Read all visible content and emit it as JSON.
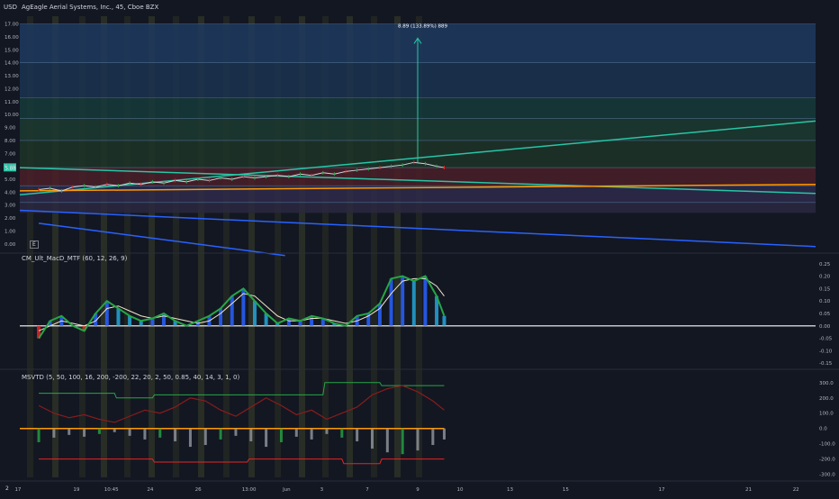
{
  "header": {
    "title": "AgEagle Aerial Systems, Inc., 45, Cboe BZX",
    "currency": "USD",
    "price_tag": "5.88",
    "measure_label": "8.89 (133.89%) 889",
    "settings_label": "E",
    "corner_label": "2"
  },
  "panes": {
    "macd_title": "CM_Ult_MacD_MTF (60, 12, 26, 9)",
    "msvtd_title": "MSVTD (5, 50, 100, 16, 200, -200, 22, 20, 2, 50, 0.85, 40, 14, 3, 1, 0)"
  },
  "colors": {
    "background": "#131722",
    "teal": "#26c6a6",
    "blue": "#2962ff",
    "green": "#26a645",
    "red": "#e52525",
    "orange": "#ff9800",
    "zone_blue": "#1f3a5f",
    "zone_green": "#1c3a30",
    "zone_red": "#4a1f28",
    "zone_purple": "#2e2a4a"
  },
  "chart_data": [
    {
      "type": "line",
      "pane": "price",
      "ylim": [
        -0.5,
        17.6
      ],
      "yticks": [
        "17.00",
        "16.00",
        "15.00",
        "14.00",
        "13.00",
        "12.00",
        "11.00",
        "10.00",
        "9.00",
        "8.00",
        "7.00",
        "6.00",
        "5.00",
        "4.00",
        "3.00",
        "2.00",
        "1.00",
        "0.00"
      ],
      "ytick_values": [
        17,
        16,
        15,
        14,
        13,
        12,
        11,
        10,
        9,
        8,
        7,
        6,
        5,
        4,
        3,
        2,
        1,
        0
      ],
      "zones": [
        {
          "from": 14.0,
          "to": 17.0,
          "color": "#1f3a5f"
        },
        {
          "from": 11.3,
          "to": 14.0,
          "color": "#1b3350"
        },
        {
          "from": 9.7,
          "to": 11.3,
          "color": "#163a3a"
        },
        {
          "from": 8.0,
          "to": 9.7,
          "color": "#1c3a30"
        },
        {
          "from": 5.9,
          "to": 8.0,
          "color": "#1d3428"
        },
        {
          "from": 4.5,
          "to": 5.9,
          "color": "#4a1f28"
        },
        {
          "from": 3.2,
          "to": 4.5,
          "color": "#2e2a4a"
        },
        {
          "from": 2.4,
          "to": 3.2,
          "color": "#2a2840"
        }
      ],
      "price": [
        [
          0,
          4.2
        ],
        [
          6,
          4.3
        ],
        [
          12,
          4.1
        ],
        [
          18,
          4.4
        ],
        [
          24,
          4.5
        ],
        [
          30,
          4.4
        ],
        [
          36,
          4.6
        ],
        [
          42,
          4.5
        ],
        [
          48,
          4.7
        ],
        [
          54,
          4.6
        ],
        [
          60,
          4.8
        ],
        [
          66,
          4.7
        ],
        [
          72,
          4.9
        ],
        [
          78,
          4.8
        ],
        [
          84,
          5.0
        ],
        [
          90,
          4.9
        ],
        [
          96,
          5.1
        ],
        [
          102,
          5.0
        ],
        [
          108,
          5.2
        ],
        [
          114,
          5.1
        ],
        [
          120,
          5.2
        ],
        [
          126,
          5.3
        ],
        [
          132,
          5.2
        ],
        [
          138,
          5.4
        ],
        [
          144,
          5.3
        ],
        [
          150,
          5.5
        ],
        [
          156,
          5.4
        ],
        [
          162,
          5.6
        ],
        [
          168,
          5.7
        ],
        [
          174,
          5.8
        ],
        [
          180,
          5.9
        ],
        [
          186,
          6.0
        ],
        [
          192,
          6.1
        ],
        [
          198,
          6.3
        ],
        [
          204,
          6.2
        ],
        [
          210,
          6.0
        ],
        [
          214,
          5.9
        ]
      ],
      "trendlines": [
        {
          "color": "#26c6a6",
          "from": [
            -10,
            3.8
          ],
          "to": [
            410,
            9.5
          ]
        },
        {
          "color": "#26c6a6",
          "from": [
            -10,
            5.9
          ],
          "to": [
            410,
            3.9
          ]
        },
        {
          "color": "#2962ff",
          "from": [
            -10,
            2.6
          ],
          "to": [
            410,
            -0.2
          ]
        },
        {
          "color": "#2962ff",
          "from": [
            0,
            1.6
          ],
          "to": [
            130,
            -0.9
          ]
        },
        {
          "color": "#ff9800",
          "from": [
            -10,
            4.1
          ],
          "to": [
            410,
            4.6
          ]
        }
      ],
      "measure": {
        "x": 200,
        "from": 6.3,
        "to": 15.9
      },
      "price_level": 5.88
    },
    {
      "type": "line",
      "pane": "macd",
      "ylim": [
        -0.16,
        0.26
      ],
      "yticks": [
        "0.25",
        "0.20",
        "0.15",
        "0.10",
        "0.05",
        "0.00",
        "-0.05",
        "-0.10",
        "-0.15"
      ],
      "ytick_values": [
        0.25,
        0.2,
        0.15,
        0.1,
        0.05,
        0,
        -0.05,
        -0.1,
        -0.15
      ],
      "macd": [
        [
          0,
          -0.05
        ],
        [
          6,
          0.02
        ],
        [
          12,
          0.04
        ],
        [
          18,
          0.0
        ],
        [
          24,
          -0.02
        ],
        [
          30,
          0.05
        ],
        [
          36,
          0.1
        ],
        [
          42,
          0.07
        ],
        [
          48,
          0.04
        ],
        [
          54,
          0.02
        ],
        [
          60,
          0.03
        ],
        [
          66,
          0.05
        ],
        [
          72,
          0.02
        ],
        [
          78,
          0.0
        ],
        [
          84,
          0.02
        ],
        [
          90,
          0.04
        ],
        [
          96,
          0.07
        ],
        [
          102,
          0.12
        ],
        [
          108,
          0.15
        ],
        [
          114,
          0.1
        ],
        [
          120,
          0.05
        ],
        [
          126,
          0.01
        ],
        [
          132,
          0.03
        ],
        [
          138,
          0.02
        ],
        [
          144,
          0.04
        ],
        [
          150,
          0.03
        ],
        [
          156,
          0.01
        ],
        [
          162,
          0.0
        ],
        [
          168,
          0.04
        ],
        [
          174,
          0.05
        ],
        [
          180,
          0.09
        ],
        [
          186,
          0.19
        ],
        [
          192,
          0.2
        ],
        [
          198,
          0.18
        ],
        [
          204,
          0.2
        ],
        [
          210,
          0.12
        ],
        [
          214,
          0.04
        ]
      ],
      "signal": [
        [
          0,
          -0.02
        ],
        [
          6,
          0.0
        ],
        [
          12,
          0.02
        ],
        [
          18,
          0.01
        ],
        [
          24,
          0.0
        ],
        [
          30,
          0.02
        ],
        [
          36,
          0.07
        ],
        [
          42,
          0.08
        ],
        [
          48,
          0.06
        ],
        [
          54,
          0.04
        ],
        [
          60,
          0.03
        ],
        [
          66,
          0.04
        ],
        [
          72,
          0.03
        ],
        [
          78,
          0.02
        ],
        [
          84,
          0.01
        ],
        [
          90,
          0.02
        ],
        [
          96,
          0.05
        ],
        [
          102,
          0.09
        ],
        [
          108,
          0.13
        ],
        [
          114,
          0.12
        ],
        [
          120,
          0.08
        ],
        [
          126,
          0.04
        ],
        [
          132,
          0.02
        ],
        [
          138,
          0.02
        ],
        [
          144,
          0.03
        ],
        [
          150,
          0.03
        ],
        [
          156,
          0.02
        ],
        [
          162,
          0.01
        ],
        [
          168,
          0.02
        ],
        [
          174,
          0.04
        ],
        [
          180,
          0.07
        ],
        [
          186,
          0.13
        ],
        [
          192,
          0.18
        ],
        [
          198,
          0.19
        ],
        [
          204,
          0.19
        ],
        [
          210,
          0.16
        ],
        [
          214,
          0.12
        ]
      ]
    },
    {
      "type": "line",
      "pane": "msvtd",
      "ylim": [
        -320,
        340
      ],
      "yticks": [
        "300.0",
        "200.0",
        "100.0",
        "0.0",
        "-100.0",
        "-200.0",
        "-300.0"
      ],
      "ytick_values": [
        300,
        200,
        100,
        0,
        -100,
        -200,
        -300
      ],
      "upper_band": [
        [
          0,
          230
        ],
        [
          40,
          230
        ],
        [
          41,
          200
        ],
        [
          60,
          200
        ],
        [
          61,
          220
        ],
        [
          150,
          220
        ],
        [
          151,
          300
        ],
        [
          180,
          300
        ],
        [
          181,
          280
        ],
        [
          214,
          280
        ]
      ],
      "lower_band": [
        [
          0,
          -200
        ],
        [
          60,
          -200
        ],
        [
          61,
          -220
        ],
        [
          110,
          -220
        ],
        [
          111,
          -200
        ],
        [
          160,
          -200
        ],
        [
          161,
          -230
        ],
        [
          180,
          -230
        ],
        [
          181,
          -200
        ],
        [
          214,
          -200
        ]
      ],
      "oscillator": [
        [
          0,
          150
        ],
        [
          8,
          100
        ],
        [
          16,
          70
        ],
        [
          24,
          90
        ],
        [
          32,
          60
        ],
        [
          40,
          40
        ],
        [
          48,
          80
        ],
        [
          56,
          120
        ],
        [
          64,
          100
        ],
        [
          72,
          140
        ],
        [
          80,
          200
        ],
        [
          88,
          180
        ],
        [
          96,
          120
        ],
        [
          104,
          80
        ],
        [
          112,
          140
        ],
        [
          120,
          200
        ],
        [
          128,
          150
        ],
        [
          136,
          90
        ],
        [
          144,
          120
        ],
        [
          152,
          60
        ],
        [
          160,
          100
        ],
        [
          168,
          140
        ],
        [
          176,
          220
        ],
        [
          184,
          260
        ],
        [
          192,
          280
        ],
        [
          200,
          240
        ],
        [
          208,
          180
        ],
        [
          214,
          120
        ]
      ]
    }
  ],
  "xaxis": {
    "labels": [
      "17",
      "19",
      "10:45",
      "24",
      "26",
      "13:00",
      "Jun",
      "3",
      "7",
      "9",
      "10",
      "13",
      "15",
      "17",
      "21",
      "22"
    ],
    "positions": [
      0.0214,
      0.0911,
      0.1327,
      0.1791,
      0.2362,
      0.2968,
      0.3416,
      0.3835,
      0.4378,
      0.4978,
      0.5483,
      0.6078,
      0.6742,
      0.7886,
      0.8922,
      0.9487
    ]
  },
  "pane_layout": {
    "price_bottom_x": 214,
    "x_domain": [
      -10,
      410
    ]
  }
}
